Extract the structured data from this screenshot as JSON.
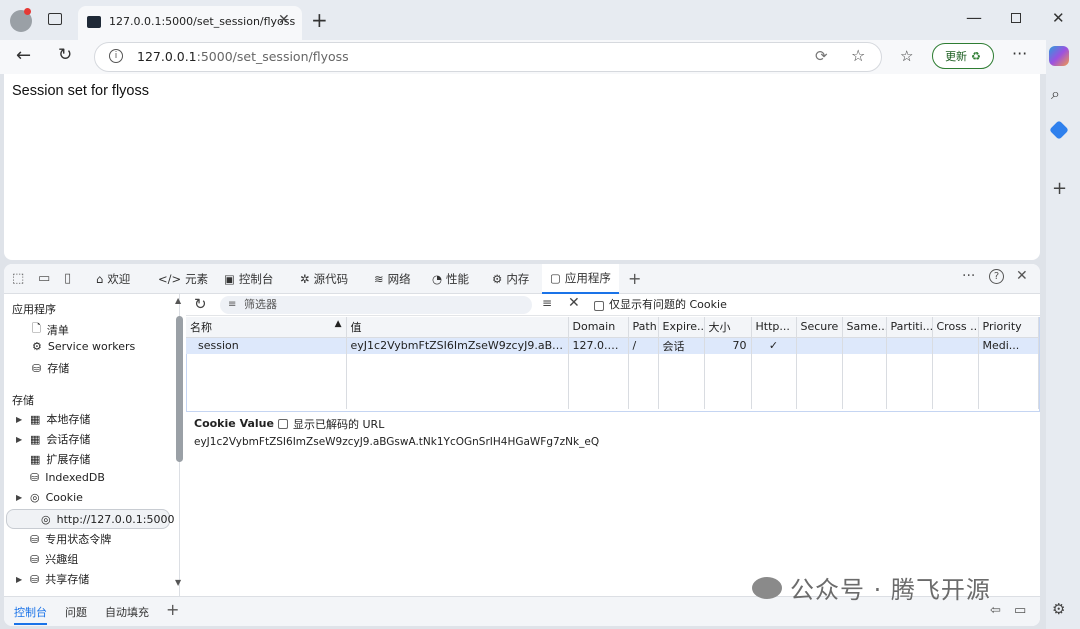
{
  "browser": {
    "tab_title": "127.0.0.1:5000/set_session/flyoss",
    "address_host": "127.0.0.1",
    "address_rest": ":5000/set_session/flyoss",
    "update_label": "更新"
  },
  "page": {
    "text": "Session set for flyoss"
  },
  "devtools": {
    "tabs": [
      {
        "label": "欢迎",
        "icon": "home-icon"
      },
      {
        "label": "元素",
        "icon": "code-icon"
      },
      {
        "label": "控制台",
        "icon": "console-icon"
      },
      {
        "label": "源代码",
        "icon": "bug-icon"
      },
      {
        "label": "网络",
        "icon": "wifi-icon"
      },
      {
        "label": "性能",
        "icon": "gauge-icon"
      },
      {
        "label": "内存",
        "icon": "memory-icon"
      },
      {
        "label": "应用程序",
        "icon": "app-icon"
      }
    ],
    "sidebar": {
      "section_app": "应用程序",
      "app_items": [
        "清单",
        "Service workers",
        "存储"
      ],
      "section_storage": "存储",
      "storage_items": [
        "本地存储",
        "会话存储",
        "扩展存储",
        "IndexedDB",
        "Cookie",
        "http://127.0.0.1:5000",
        "专用状态令牌",
        "兴趣组",
        "共享存储"
      ]
    },
    "filter": {
      "placeholder": "筛选器",
      "only_issues_label": "仅显示有问题的 Cookie"
    },
    "columns": [
      "名称",
      "值",
      "Domain",
      "Path",
      "Expire...",
      "大小",
      "Http...",
      "Secure",
      "Same...",
      "Partiti...",
      "Cross ...",
      "Priority"
    ],
    "rows": [
      {
        "name": "session",
        "value": "eyJ1c2VybmFtZSI6ImZseW9zcyJ9.aBGswA...",
        "domain": "127.0.0.1",
        "path": "/",
        "expires": "会话",
        "size": "70",
        "http": "✓",
        "secure": "",
        "same": "",
        "partition": "",
        "cross": "",
        "priority": "Medi..."
      }
    ],
    "cookie_value": {
      "title": "Cookie Value",
      "decode_label": "显示已解码的 URL",
      "value": "eyJ1c2VybmFtZSI6ImZseW9zcyJ9.aBGswA.tNk1YcOGnSrIH4HGaWFg7zNk_eQ"
    },
    "bottom_tabs": [
      "控制台",
      "问题",
      "自动填充"
    ]
  },
  "watermark": "公众号 · 腾飞开源"
}
